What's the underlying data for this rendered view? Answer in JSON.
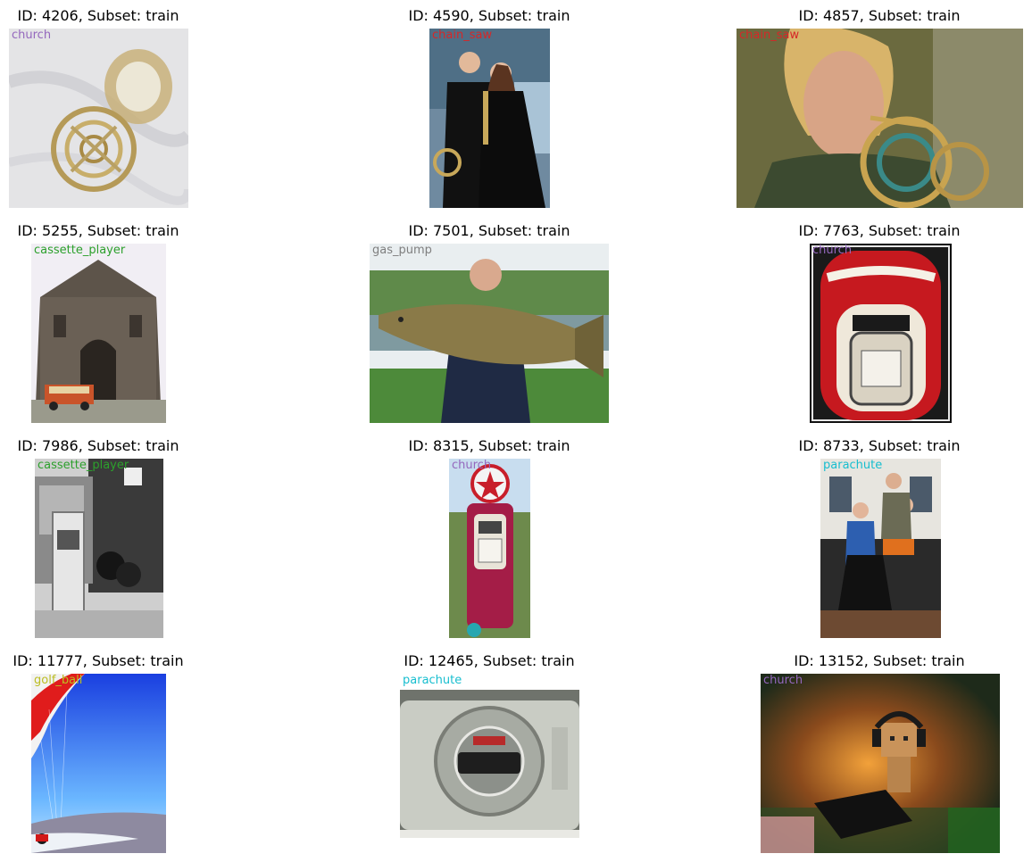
{
  "cells": [
    {
      "title": "ID: 4206, Subset: train",
      "label": "church",
      "label_color": "#9467bd",
      "subject": "french-horn-on-white-cloth"
    },
    {
      "title": "ID: 4590, Subset: train",
      "label": "chain_saw",
      "label_color": "#d62728",
      "subject": "couple-with-french-horn"
    },
    {
      "title": "ID: 4857, Subset: train",
      "label": "chain_saw",
      "label_color": "#d62728",
      "subject": "woman-playing-french-horn"
    },
    {
      "title": "ID: 5255, Subset: train",
      "label": "cassette_player",
      "label_color": "#2ca02c",
      "subject": "old-stone-church"
    },
    {
      "title": "ID: 7501, Subset: train",
      "label": "gas_pump",
      "label_color": "#7f7f7f",
      "subject": "man-holding-large-fish"
    },
    {
      "title": "ID: 7763, Subset: train",
      "label": "church",
      "label_color": "#9467bd",
      "subject": "mobilgas-pump"
    },
    {
      "title": "ID: 7986, Subset: train",
      "label": "cassette_player",
      "label_color": "#2ca02c",
      "subject": "old-gas-pump-black-and-white"
    },
    {
      "title": "ID: 8315, Subset: train",
      "label": "church",
      "label_color": "#9467bd",
      "subject": "texaco-gas-pump"
    },
    {
      "title": "ID: 8733, Subset: train",
      "label": "parachute",
      "label_color": "#17becf",
      "subject": "group-with-chainsaw"
    },
    {
      "title": "ID: 11777, Subset: train",
      "label": "golf_ball",
      "label_color": "#bcbd22",
      "subject": "paraglider-sky"
    },
    {
      "title": "ID: 12465, Subset: train",
      "label": "parachute",
      "label_color": "#17becf",
      "subject": "cassette-player"
    },
    {
      "title": "ID: 13152, Subset: train",
      "label": "church",
      "label_color": "#9467bd",
      "subject": "cardboard-robot-with-headphones"
    }
  ]
}
